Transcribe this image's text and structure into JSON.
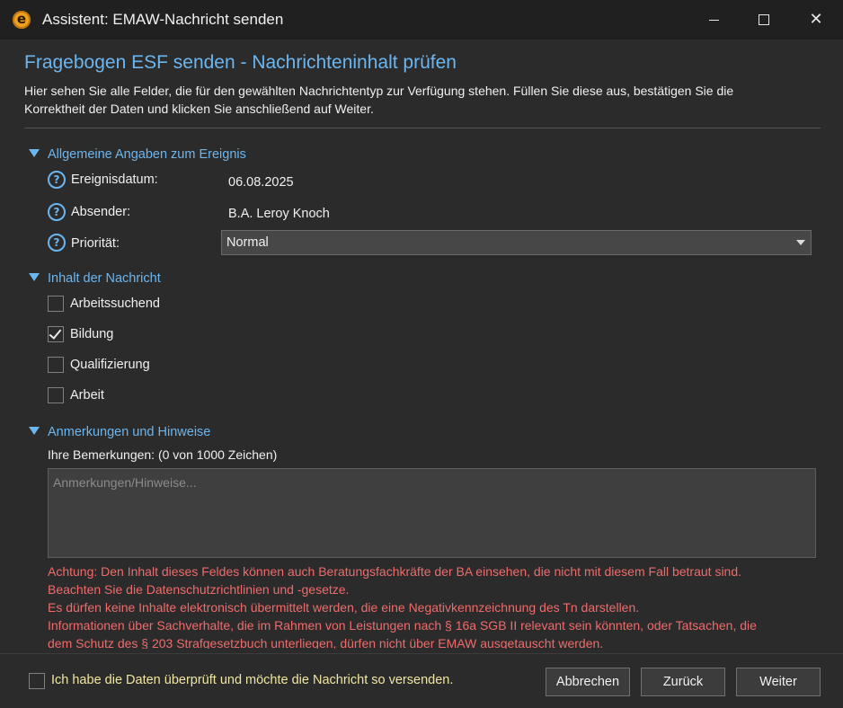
{
  "window": {
    "logo_letter": "e",
    "title": "Assistent: EMAW-Nachricht senden",
    "minimize": "",
    "maximize": "",
    "close": "✕"
  },
  "page": {
    "title": "Fragebogen ESF senden - Nachrichteninhalt prüfen",
    "intro_line1": "Hier sehen Sie alle Felder, die für den gewählten Nachrichtentyp zur Verfügung stehen. Füllen Sie diese aus, bestätigen Sie die",
    "intro_line2": "Korrektheit der Daten und klicken Sie anschließend auf Weiter."
  },
  "general": {
    "heading": "Allgemeine Angaben zum Ereignis",
    "date_label": "Ereignisdatum:",
    "date_value": "06.08.2025",
    "sender_label": "Absender:",
    "sender_value": "B.A. Leroy Knoch",
    "priority_label": "Priorität:",
    "priority_value": "Normal"
  },
  "content": {
    "heading": "Inhalt der Nachricht",
    "options": [
      {
        "label": "Arbeitssuchend",
        "checked": false
      },
      {
        "label": "Bildung",
        "checked": true
      },
      {
        "label": "Qualifizierung",
        "checked": false
      },
      {
        "label": "Arbeit",
        "checked": false
      }
    ]
  },
  "notes": {
    "heading": "Anmerkungen und Hinweise",
    "label": "Ihre Bemerkungen: (0 von 1000 Zeichen)",
    "placeholder": "Anmerkungen/Hinweise...",
    "warning_lines": [
      "Achtung: Den Inhalt dieses Feldes können auch Beratungsfachkräfte der BA einsehen, die nicht mit diesem Fall betraut sind.",
      "Beachten Sie die Datenschutzrichtlinien und -gesetze.",
      "Es dürfen keine Inhalte elektronisch übermittelt werden, die eine Negativkennzeichnung des Tn darstellen.",
      "Informationen über Sachverhalte, die im Rahmen von Leistungen nach § 16a SGB II relevant sein könnten, oder Tatsachen, die",
      "dem Schutz des § 203 Strafgesetzbuch unterliegen, dürfen nicht über EMAW ausgetauscht werden."
    ]
  },
  "footer": {
    "confirm_label": "Ich habe die Daten überprüft und möchte die Nachricht so versenden.",
    "confirm_checked": false,
    "cancel": "Abbrechen",
    "back": "Zurück",
    "next": "Weiter"
  },
  "colors": {
    "accent": "#6cb6f0",
    "warning": "#ef6b6b",
    "confirm_text": "#f0e6a0",
    "background": "#2b2b2b"
  }
}
